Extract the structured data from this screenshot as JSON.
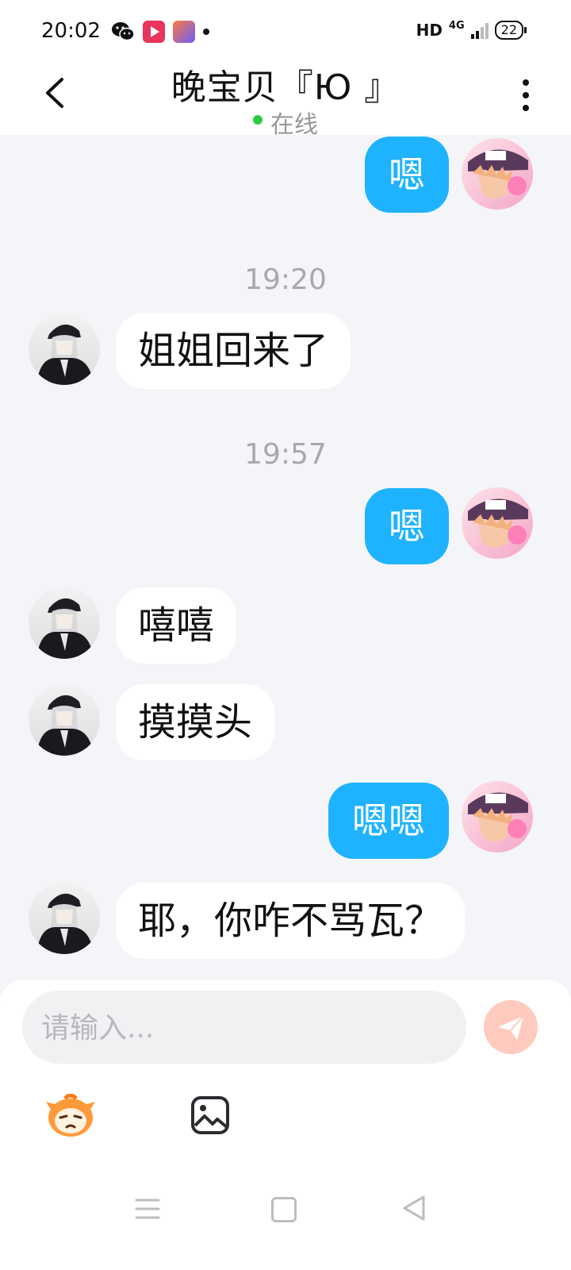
{
  "status_bar": {
    "time": "20:02",
    "left_icons": [
      "wechat-icon",
      "video-app-icon",
      "shortcut-app-icon",
      "notification-dot"
    ],
    "hd": "HD",
    "network": "4G",
    "battery": "22"
  },
  "header": {
    "title": "晚宝贝『Ю 』",
    "status": "在线",
    "status_color": "#2ecc40"
  },
  "messages": [
    {
      "direction": "out",
      "text": "嗯"
    },
    {
      "type": "time",
      "text": "19:20"
    },
    {
      "direction": "in",
      "text": "姐姐回来了"
    },
    {
      "type": "time",
      "text": "19:57"
    },
    {
      "direction": "out",
      "text": "嗯"
    },
    {
      "direction": "in",
      "text": "嘻嘻"
    },
    {
      "direction": "in",
      "text": "摸摸头"
    },
    {
      "direction": "out",
      "text": "嗯嗯"
    },
    {
      "direction": "in",
      "text": "耶，你咋不骂瓦？"
    }
  ],
  "input": {
    "placeholder": "请输入..."
  },
  "colors": {
    "outgoing_bubble": "#1fb3ff",
    "incoming_bubble": "#ffffff",
    "send_button": "#ffcbbf",
    "background": "#f4f5f9"
  },
  "toolbar_icons": [
    "emoji-sticker-icon",
    "image-icon"
  ],
  "nav_icons": [
    "menu-icon",
    "home-icon",
    "back-triangle-icon"
  ]
}
